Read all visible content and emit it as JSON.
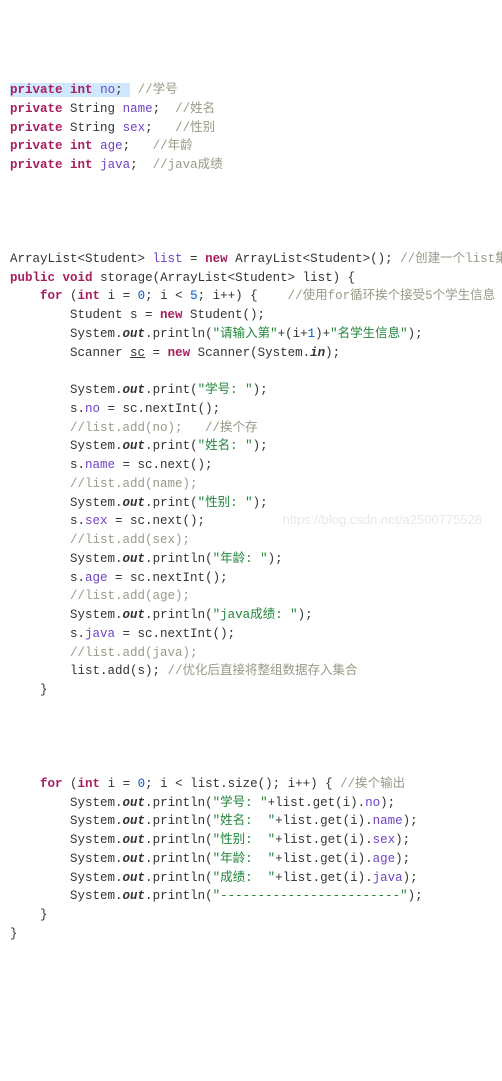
{
  "line1_sel_kw1": "private",
  "line1_sel_kw2": "int",
  "line1_sel_sp": " ",
  "line1_sel_fld": "no",
  "line1_sel_semi": "; ",
  "line1_cmt": "//学号",
  "line2_kw1": "private",
  "line2_type": "String",
  "line2_fld": "name",
  "line2_cmt": "//姓名",
  "line3_kw1": "private",
  "line3_type": "String",
  "line3_fld": "sex",
  "line3_cmt": "//性别",
  "line4_kw1": "private",
  "line4_kw2": "int",
  "line4_fld": "age",
  "line4_cmt": "//年龄",
  "line5_kw1": "private",
  "line5_kw2": "int",
  "line5_fld": "java",
  "line5_cmt": "//java成绩",
  "decl_kw_new": "new",
  "decl_cmt": "//创建一个list集合",
  "decl_txt1": "ArrayList<Student> ",
  "decl_txt2": "list",
  "decl_txt3": " = ",
  "decl_txt4": " ArrayList<Student>(); ",
  "pub_kw": "public",
  "void_kw": "void",
  "storage_name": "storage",
  "storage_params": "(ArrayList<Student> list) {",
  "for1_kw": "for",
  "for1_int": "int",
  "for1_init": " i = ",
  "for1_zero": "0",
  "for1_cond": "; i < ",
  "for1_five": "5",
  "for1_tail": "; i++) {    ",
  "for1_cmt": "//使用for循环挨个接受5个学生信息",
  "stu_txt1": "Student s = ",
  "stu_new": "new",
  "stu_txt2": " Student();",
  "sys": "System.",
  "out": "out",
  "in": "in",
  "dot": ".",
  "print": "print",
  "println": "println",
  "p1_open": "(",
  "p1_str": "\"请输入第\"",
  "p1_mid": "+(i+",
  "p1_one": "1",
  "p1_mid2": ")+",
  "p1_str2": "\"名学生信息\"",
  "p1_close": ");",
  "sc_txt1": "Scanner ",
  "sc_var": "sc",
  "sc_txt2": " = ",
  "sc_new": "new",
  "sc_txt3": " Scanner(System.",
  "sc_txt4": ");",
  "pr_xuehao_str": "\"学号: \"",
  "assign_no": "s.",
  "fld_no": "no",
  "assign_no_tail": " = sc.nextInt();",
  "cmt_cache": "//挨个存",
  "cmt_listadd_no": "//list.add(no);   ",
  "pr_xingming_str": "\"姓名: \"",
  "fld_name": "name",
  "assign_name_tail": " = sc.next();",
  "cmt_listadd_name": "//list.add(name);",
  "pr_xingbie_str": "\"性别: \"",
  "fld_sex": "sex",
  "assign_sex_tail": " = sc.next();",
  "cmt_listadd_sex": "//list.add(sex);",
  "pr_nianling_str": "\"年龄: \"",
  "fld_age": "age",
  "assign_age_tail": " = sc.nextInt();",
  "cmt_listadd_age": "//list.add(age);",
  "pr_java_str": "\"java成绩: \"",
  "fld_java": "java",
  "assign_java_tail": " = sc.nextInt();",
  "cmt_listadd_java": "//list.add(java);",
  "listadd_s": "list.add(s); ",
  "cmt_opt": "//优化后直接将整组数据存入集合",
  "brace_close": "}",
  "for2_kw": "for",
  "for2_int": "int",
  "for2_init": " i = ",
  "for2_zero": "0",
  "for2_cond": "; i < list.size(); i++) { ",
  "for2_cmt": "//挨个输出",
  "out_xh_str": "\"学号: \"",
  "out_xh_tail": "+list.get(i).",
  "out_close": ");",
  "out_xm_str": "\"姓名:  \"",
  "out_xb_str": "\"性别:  \"",
  "out_nl_str": "\"年龄:  \"",
  "out_cj_str": "\"成绩:  \"",
  "out_dash_str": "\"------------------------\"",
  "watermark": "https://blog.csdn.net/a2500775528"
}
